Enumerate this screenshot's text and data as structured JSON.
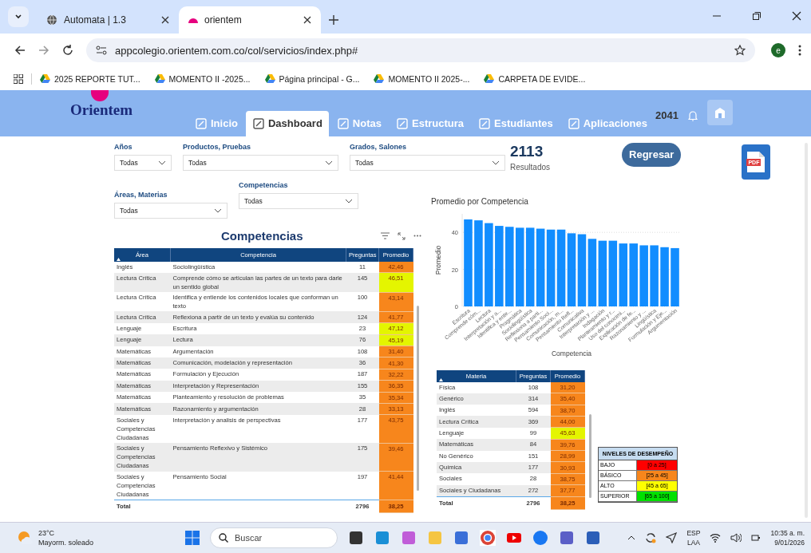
{
  "browser": {
    "tabs": [
      {
        "title": "Automata | 1.3",
        "selected": false
      },
      {
        "title": "orientem",
        "selected": true
      }
    ],
    "address": "appcolegio.orientem.com.co/col/servicios/index.php#",
    "profile_initial": "e",
    "bookmarks": [
      "2025 REPORTE TUT...",
      "MOMENTO II -2025...",
      "Página principal - G...",
      "MOMENTO II 2025-...",
      "CARPETA DE EVIDE..."
    ]
  },
  "app": {
    "logo": "Orientem",
    "nav": [
      {
        "label": "Inicio",
        "selected": false
      },
      {
        "label": "Dashboard",
        "selected": true
      },
      {
        "label": "Notas",
        "selected": false
      },
      {
        "label": "Estructura",
        "selected": false
      },
      {
        "label": "Estudiantes",
        "selected": false
      },
      {
        "label": "Aplicaciones",
        "selected": false
      }
    ],
    "count": "2041"
  },
  "filters": [
    {
      "label": "Años",
      "value": "Todas"
    },
    {
      "label": "Productos, Pruebas",
      "value": "Todas"
    },
    {
      "label": "Grados, Salones",
      "value": "Todas"
    }
  ],
  "filters_secondary": [
    {
      "label": "Áreas, Materias",
      "value": "Todas"
    },
    {
      "label": "Competencias",
      "value": "Todas"
    }
  ],
  "results": {
    "value": "2113",
    "label": "Resultados"
  },
  "back_button": "Regresar",
  "pdf_label": "PDF",
  "competencias_table": {
    "title": "Competencias",
    "columns": [
      "Área",
      "Competencia",
      "Preguntas",
      "Promedio"
    ],
    "rows": [
      {
        "area": "Inglés",
        "competencia": "Sociolingüística",
        "preguntas": "11",
        "promedio": "42,46",
        "color": "#f7861c"
      },
      {
        "area": "Lectura Crítica",
        "competencia": "Comprende cómo se articulan las partes de un texto para darle un sentido global",
        "preguntas": "145",
        "promedio": "46,51",
        "color": "#e4f500"
      },
      {
        "area": "Lectura Crítica",
        "competencia": "Identifica y entiende los contenidos locales que conforman un texto",
        "preguntas": "100",
        "promedio": "43,14",
        "color": "#f7861c"
      },
      {
        "area": "Lectura Crítica",
        "competencia": "Reflexiona a partir de un texto y evalúa su contenido",
        "preguntas": "124",
        "promedio": "41,77",
        "color": "#f7861c"
      },
      {
        "area": "Lenguaje",
        "competencia": "Escritura",
        "preguntas": "23",
        "promedio": "47,12",
        "color": "#e4f500"
      },
      {
        "area": "Lenguaje",
        "competencia": "Lectura",
        "preguntas": "76",
        "promedio": "45,19",
        "color": "#e4f500"
      },
      {
        "area": "Matemáticas",
        "competencia": "Argumentación",
        "preguntas": "108",
        "promedio": "31,40",
        "color": "#f7861c"
      },
      {
        "area": "Matemáticas",
        "competencia": "Comunicación, modelación y representación",
        "preguntas": "36",
        "promedio": "41,30",
        "color": "#f7861c"
      },
      {
        "area": "Matemáticas",
        "competencia": "Formulación y Ejecución",
        "preguntas": "187",
        "promedio": "32,22",
        "color": "#f7861c"
      },
      {
        "area": "Matemáticas",
        "competencia": "Interpretación y Representación",
        "preguntas": "155",
        "promedio": "36,35",
        "color": "#f7861c"
      },
      {
        "area": "Matemáticas",
        "competencia": "Planteamiento y resolución de problemas",
        "preguntas": "35",
        "promedio": "35,34",
        "color": "#f7861c"
      },
      {
        "area": "Matemáticas",
        "competencia": "Razonamiento y argumentación",
        "preguntas": "28",
        "promedio": "33,13",
        "color": "#f7861c"
      },
      {
        "area": "Sociales y Competencias Ciudadanas",
        "competencia": "Interpretación y analisis de perspectivas",
        "preguntas": "177",
        "promedio": "43,75",
        "color": "#f7861c"
      },
      {
        "area": "Sociales y Competencias Ciudadanas",
        "competencia": "Pensamiento Reflexivo y Sistémico",
        "preguntas": "175",
        "promedio": "39,46",
        "color": "#f7861c"
      },
      {
        "area": "Sociales y Competencias Ciudadanas",
        "competencia": "Pensamiento Social",
        "preguntas": "197",
        "promedio": "41,44",
        "color": "#f7861c"
      }
    ],
    "total": {
      "label": "Total",
      "preguntas": "2796",
      "promedio": "38,25",
      "color": "#f7861c"
    }
  },
  "chart": {
    "title": "Promedio por Competencia",
    "chart_data": {
      "type": "bar",
      "xlabel": "Competencia",
      "ylabel": "Promedio",
      "categories": [
        "Escritura",
        "Comprende cóm...",
        "Lectura",
        "Interpretación y a...",
        "Identifica y ente...",
        "Pragmática",
        "Sociolingüística",
        "Reflexiona a parti...",
        "Pensamiento Soci...",
        "Comunicación, m...",
        "Pensamiento Refl...",
        "Comunicativa",
        "Interpretación y ...",
        "Indagación",
        "Planteamiento y r...",
        "Uso del conocimi...",
        "Explicación de fe...",
        "Razonamiento y ...",
        "Lingüística",
        "Formulación y Eje...",
        "Argumentación"
      ],
      "series": [
        {
          "color": "#118dff",
          "values": [
            47,
            46.5,
            45,
            43.5,
            43,
            42.5,
            42.5,
            42,
            41.5,
            41.5,
            39.5,
            39,
            36.5,
            35.5,
            35.5,
            34,
            34,
            33,
            33,
            32,
            31.5
          ]
        }
      ],
      "ylim": [
        0,
        50
      ],
      "yticks": [
        0,
        20,
        40
      ]
    }
  },
  "materias_table": {
    "columns": [
      "Materia",
      "Preguntas",
      "Promedio"
    ],
    "rows": [
      {
        "materia": "Física",
        "preguntas": "108",
        "promedio": "31,20",
        "color": "#f7861c"
      },
      {
        "materia": "Genérico",
        "preguntas": "314",
        "promedio": "35,40",
        "color": "#f7861c"
      },
      {
        "materia": "Inglés",
        "preguntas": "594",
        "promedio": "38,70",
        "color": "#f7861c"
      },
      {
        "materia": "Lectura Crítica",
        "preguntas": "369",
        "promedio": "44,00",
        "color": "#f7861c"
      },
      {
        "materia": "Lenguaje",
        "preguntas": "99",
        "promedio": "45,63",
        "color": "#e4f500"
      },
      {
        "materia": "Matemáticas",
        "preguntas": "84",
        "promedio": "39,76",
        "color": "#f7861c"
      },
      {
        "materia": "No Genérico",
        "preguntas": "151",
        "promedio": "28,99",
        "color": "#f7861c"
      },
      {
        "materia": "Química",
        "preguntas": "177",
        "promedio": "30,93",
        "color": "#f7861c"
      },
      {
        "materia": "Sociales",
        "preguntas": "28",
        "promedio": "38,75",
        "color": "#f7861c"
      },
      {
        "materia": "Sociales y Ciudadanas",
        "preguntas": "272",
        "promedio": "37,77",
        "color": "#f7861c"
      }
    ],
    "total": {
      "label": "Total",
      "preguntas": "2796",
      "promedio": "38,25",
      "color": "#f7861c"
    }
  },
  "levels": {
    "title": "NIVELES DE DESEMPEÑO",
    "items": [
      {
        "label": "BAJO",
        "range": "[0 a 25]",
        "color": "#ff0000"
      },
      {
        "label": "BÁSICO",
        "range": "[25 a 45]",
        "color": "#f7861c"
      },
      {
        "label": "ALTO",
        "range": "[45 a 65]",
        "color": "#ffff00"
      },
      {
        "label": "SUPERIOR",
        "range": "[65 a 100]",
        "color": "#00e000"
      }
    ]
  },
  "taskbar": {
    "temperature": "23°C",
    "weather": "Mayorm. soleado",
    "search_placeholder": "Buscar",
    "language": "ESP",
    "layout": "LAA",
    "time": "10:35 a. m.",
    "date": "9/01/2026"
  }
}
